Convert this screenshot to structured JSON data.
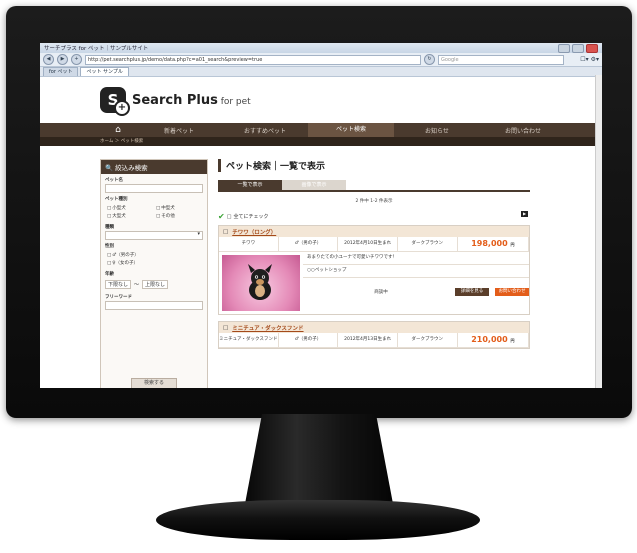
{
  "browser": {
    "window_title": "サーチプラス for ペット｜サンプルサイト",
    "url": "http://pet.searchplus.jp/demo/data.php?c=a01_search&preview=true",
    "search_placeholder": "Google",
    "tabs": [
      "for ペット",
      "ペット サンプル"
    ]
  },
  "site": {
    "logo_mark": "S",
    "logo_plus": "+",
    "logo_name": "Search Plus",
    "logo_suffix": " for pet"
  },
  "nav": {
    "home_icon": "house-icon",
    "items": [
      "新着ペット",
      "おすすめペット",
      "ペット検索",
      "お知らせ",
      "お問い合わせ"
    ],
    "active_index": 2
  },
  "breadcrumb": "ホーム ＞ ペット検索",
  "sidebar": {
    "title": "絞込み検索",
    "fields": {
      "pet_name_label": "ペット名",
      "pet_type_label": "ペット種別",
      "type_options": [
        "小型犬",
        "中型犬",
        "大型犬",
        "その他"
      ],
      "breed_label": "種類",
      "gender_label": "性別",
      "gender_options": [
        "♂（男の子）",
        "♀（女の子）"
      ],
      "age_label": "年齢",
      "age_from": "下限なし",
      "age_sep": "～",
      "age_to": "上限なし",
      "keyword_label": "フリーワード"
    },
    "search_button": "検索する"
  },
  "main": {
    "title": "ペット検索｜一覧で表示",
    "view_tabs": [
      "一覧で表示",
      "画像で表示"
    ],
    "result_count": "2 件中 1-2 件表示",
    "check_all": "全てにチェック",
    "pets": [
      {
        "name": "チワワ（ロング）",
        "breed": "チワワ",
        "gender": "♂（男の子）",
        "birth": "2012年4月10日生まれ",
        "color": "ダークブラウン",
        "price": "198,000",
        "price_unit": "円",
        "description": "あまりたての小ユーナで可愛いチワワです！",
        "shop": "○○ペットショップ",
        "status": "商談中",
        "detail_button": "詳細を見る",
        "inquiry_button": "お問い合わせ"
      },
      {
        "name": "ミニチュア・ダックスフンド",
        "breed": "ミニチュア・ダックスフンド",
        "gender": "♂（男の子）",
        "birth": "2012年4月13日生まれ",
        "color": "ダークブラウン",
        "price": "210,000",
        "price_unit": "円"
      }
    ]
  },
  "colors": {
    "brand_brown": "#4a3a2e",
    "accent_orange": "#e35d1a"
  }
}
